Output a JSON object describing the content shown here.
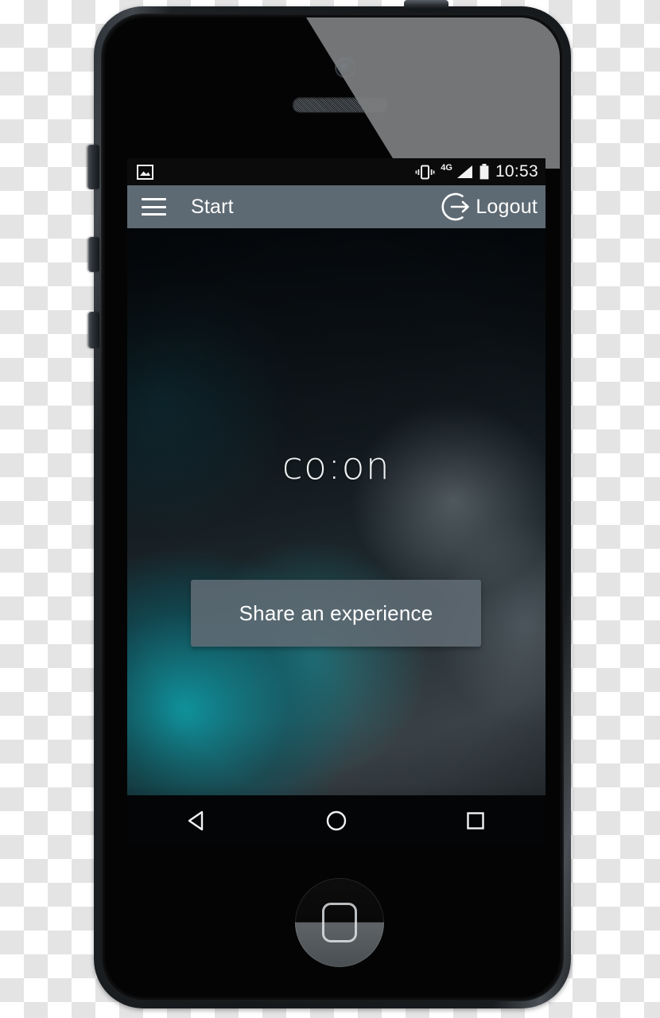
{
  "device": {
    "name": "smartphone-mockup",
    "hardware": {
      "front_camera": "camera-icon",
      "earpiece": "speaker-grille",
      "home_button": "home-button",
      "silent_switch": "silent-switch",
      "volume_up": "volume-up-button",
      "volume_down": "volume-down-button",
      "power": "power-button"
    }
  },
  "statusbar": {
    "left_icons": [
      "gallery-icon"
    ],
    "right_icons": [
      "vibrate-icon",
      "signal-4g-icon",
      "battery-icon"
    ],
    "network_label": "4G",
    "time": "10:53",
    "background": "#0b0b0b"
  },
  "appbar": {
    "menu_icon": "hamburger-icon",
    "title": "Start",
    "logout_icon": "logout-icon",
    "logout_label": "Logout",
    "background": "#5e6a73",
    "text_color": "#fdfdfd"
  },
  "screen": {
    "logo": "co:on",
    "primary_button": {
      "label": "Share an experience",
      "background": "#606b74",
      "text_color": "#ffffff"
    },
    "wallpaper": {
      "description": "blurred dark teal and grey gradient",
      "accent": "#0e96a0",
      "dark": "#0c1216"
    }
  },
  "navbar": {
    "buttons": [
      {
        "name": "back-button",
        "icon": "triangle-left-icon"
      },
      {
        "name": "home-button",
        "icon": "circle-icon"
      },
      {
        "name": "recents-button",
        "icon": "square-icon"
      }
    ],
    "background": "#040507",
    "icon_color": "#f2f2f2"
  }
}
